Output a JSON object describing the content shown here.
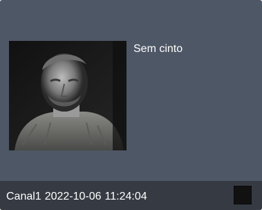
{
  "event": {
    "label": "Sem cinto"
  },
  "footer": {
    "channel": "Canal1",
    "date": "2022-10-06",
    "time": "11:24:04"
  },
  "thumbnail": {
    "icon": "camera-snapshot"
  },
  "colors": {
    "card_background": "#4e5766",
    "footer_background": "#363a42",
    "text": "#ffffff",
    "checkbox": "#111111"
  }
}
